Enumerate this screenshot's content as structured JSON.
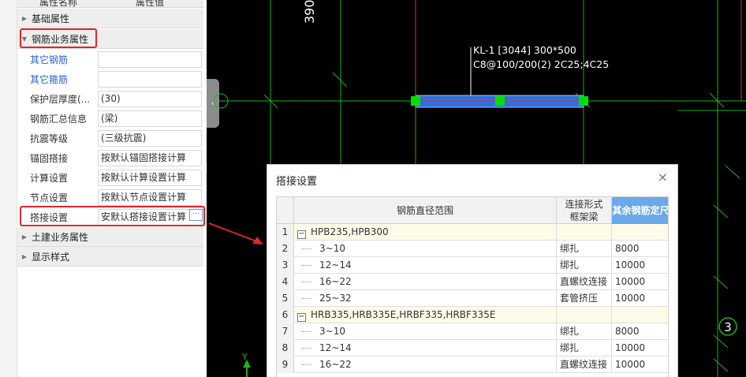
{
  "property_panel": {
    "header": {
      "col_name": "属性名称",
      "col_value": "属性值"
    },
    "groups": {
      "basic": "基础属性",
      "rebar_business": "钢筋业务属性",
      "civil_business": "土建业务属性",
      "display_style": "显示样式"
    },
    "rows": [
      {
        "label": "其它钢筋",
        "value": ""
      },
      {
        "label": "其它箍筋",
        "value": ""
      },
      {
        "label": "保护层厚度(...",
        "value": "(30)"
      },
      {
        "label": "钢筋汇总信息",
        "value": "(梁)"
      },
      {
        "label": "抗震等级",
        "value": "(三级抗震)"
      },
      {
        "label": "锚固搭接",
        "value": "按默认锚固搭接计算"
      },
      {
        "label": "计算设置",
        "value": "按默认计算设置计算"
      },
      {
        "label": "节点设置",
        "value": "按默认节点设置计算"
      },
      {
        "label": "搭接设置",
        "value": "安默认搭接设置计算"
      }
    ],
    "dots_label": "···",
    "collapse_arrow": "‹"
  },
  "cad": {
    "dimension_text": "390",
    "beam_label_line1": "KL-1 [3044] 300*500",
    "beam_label_line2": "C8@100/200(2) 2C25;4C25",
    "axis_bubble": "3",
    "axis_y_label": "Y",
    "colors": {
      "grid_green": "#1db21d",
      "beam_blue": "#2f6fe0",
      "axis_red": "#e03030",
      "grip_green": "#00e000"
    }
  },
  "dialog": {
    "title": "搭接设置",
    "close_icon": "×",
    "columns": {
      "range": "钢筋直径范围",
      "conn_line1": "连接形式",
      "conn_line2": "框架梁",
      "length": "其余钢筋定尺"
    },
    "rows": [
      {
        "num": "1",
        "group": true,
        "range": "HPB235,HPB300",
        "conn": "",
        "len": ""
      },
      {
        "num": "2",
        "group": false,
        "range": "3~10",
        "conn": "绑扎",
        "len": "8000"
      },
      {
        "num": "3",
        "group": false,
        "range": "12~14",
        "conn": "绑扎",
        "len": "10000"
      },
      {
        "num": "4",
        "group": false,
        "range": "16~22",
        "conn": "直螺纹连接",
        "len": "10000"
      },
      {
        "num": "5",
        "group": false,
        "range": "25~32",
        "conn": "套管挤压",
        "len": "10000"
      },
      {
        "num": "6",
        "group": true,
        "range": "HRB335,HRB335E,HRBF335,HRBF335E",
        "conn": "",
        "len": ""
      },
      {
        "num": "7",
        "group": false,
        "range": "3~10",
        "conn": "绑扎",
        "len": "8000"
      },
      {
        "num": "8",
        "group": false,
        "range": "12~14",
        "conn": "绑扎",
        "len": "10000"
      },
      {
        "num": "9",
        "group": false,
        "range": "16~22",
        "conn": "直螺纹连接",
        "len": "10000"
      }
    ],
    "expander": "−"
  }
}
